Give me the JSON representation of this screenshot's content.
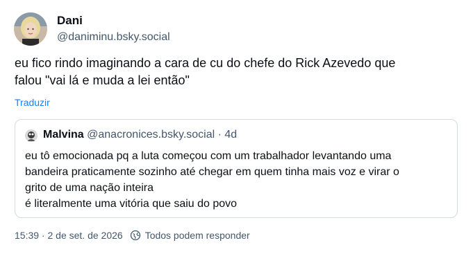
{
  "author": {
    "display_name": "Dani",
    "handle": "@daniminu.bsky.social",
    "avatar_icon": "user-avatar"
  },
  "post": {
    "text": "eu fico rindo imaginando a cara de cu do chefe do Rick Azevedo que\nfalou \"vai lá e muda a lei então\"",
    "translate_label": "Traduzir"
  },
  "quote": {
    "display_name": "Malvina",
    "handle": "@anacronices.bsky.social",
    "separator": "·",
    "time": "4d",
    "text": "eu tô emocionada pq a luta começou com um trabalhador levantando uma\nbandeira praticamente sozinho até chegar em quem tinha mais voz e virar o\ngrito de uma nação inteira\né literalmente uma vitória que saiu do povo",
    "avatar_icon": "user-avatar"
  },
  "footer": {
    "timestamp": "15:39 · 2 de set. de 2026",
    "reply_setting": "Todos podem responder",
    "reply_icon": "globe-icon"
  },
  "colors": {
    "link": "#1083fe",
    "muted": "#42576c",
    "border": "#d4dbe2"
  }
}
